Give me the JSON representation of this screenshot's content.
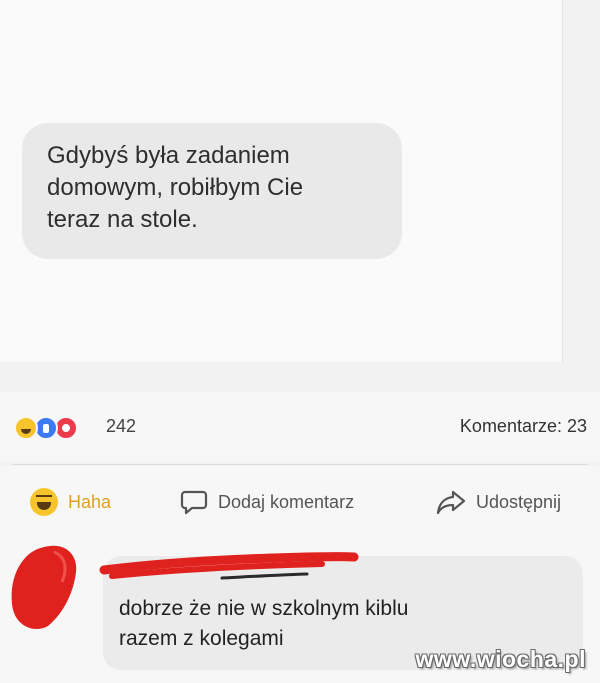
{
  "post": {
    "message": "Gdybyś była zadaniem\ndomowym, robiłbym Cie\nteraz na stole."
  },
  "stats": {
    "reactions": [
      "haha-icon",
      "like-icon",
      "love-icon"
    ],
    "reaction_count": "242",
    "comments_label": "Komentarze: 23"
  },
  "actions": {
    "haha_label": "Haha",
    "comment_label": "Dodaj komentarz",
    "share_label": "Udostępnij"
  },
  "comment": {
    "author": "",
    "text": "dobrze że nie w szkolnym kiblu\nrazem z kolegami"
  },
  "watermark": "www.wiocha.pl",
  "colors": {
    "haha": "#f7c52b",
    "like": "#3b7af0",
    "love": "#ee3b4b",
    "scribble": "#e0221f"
  }
}
